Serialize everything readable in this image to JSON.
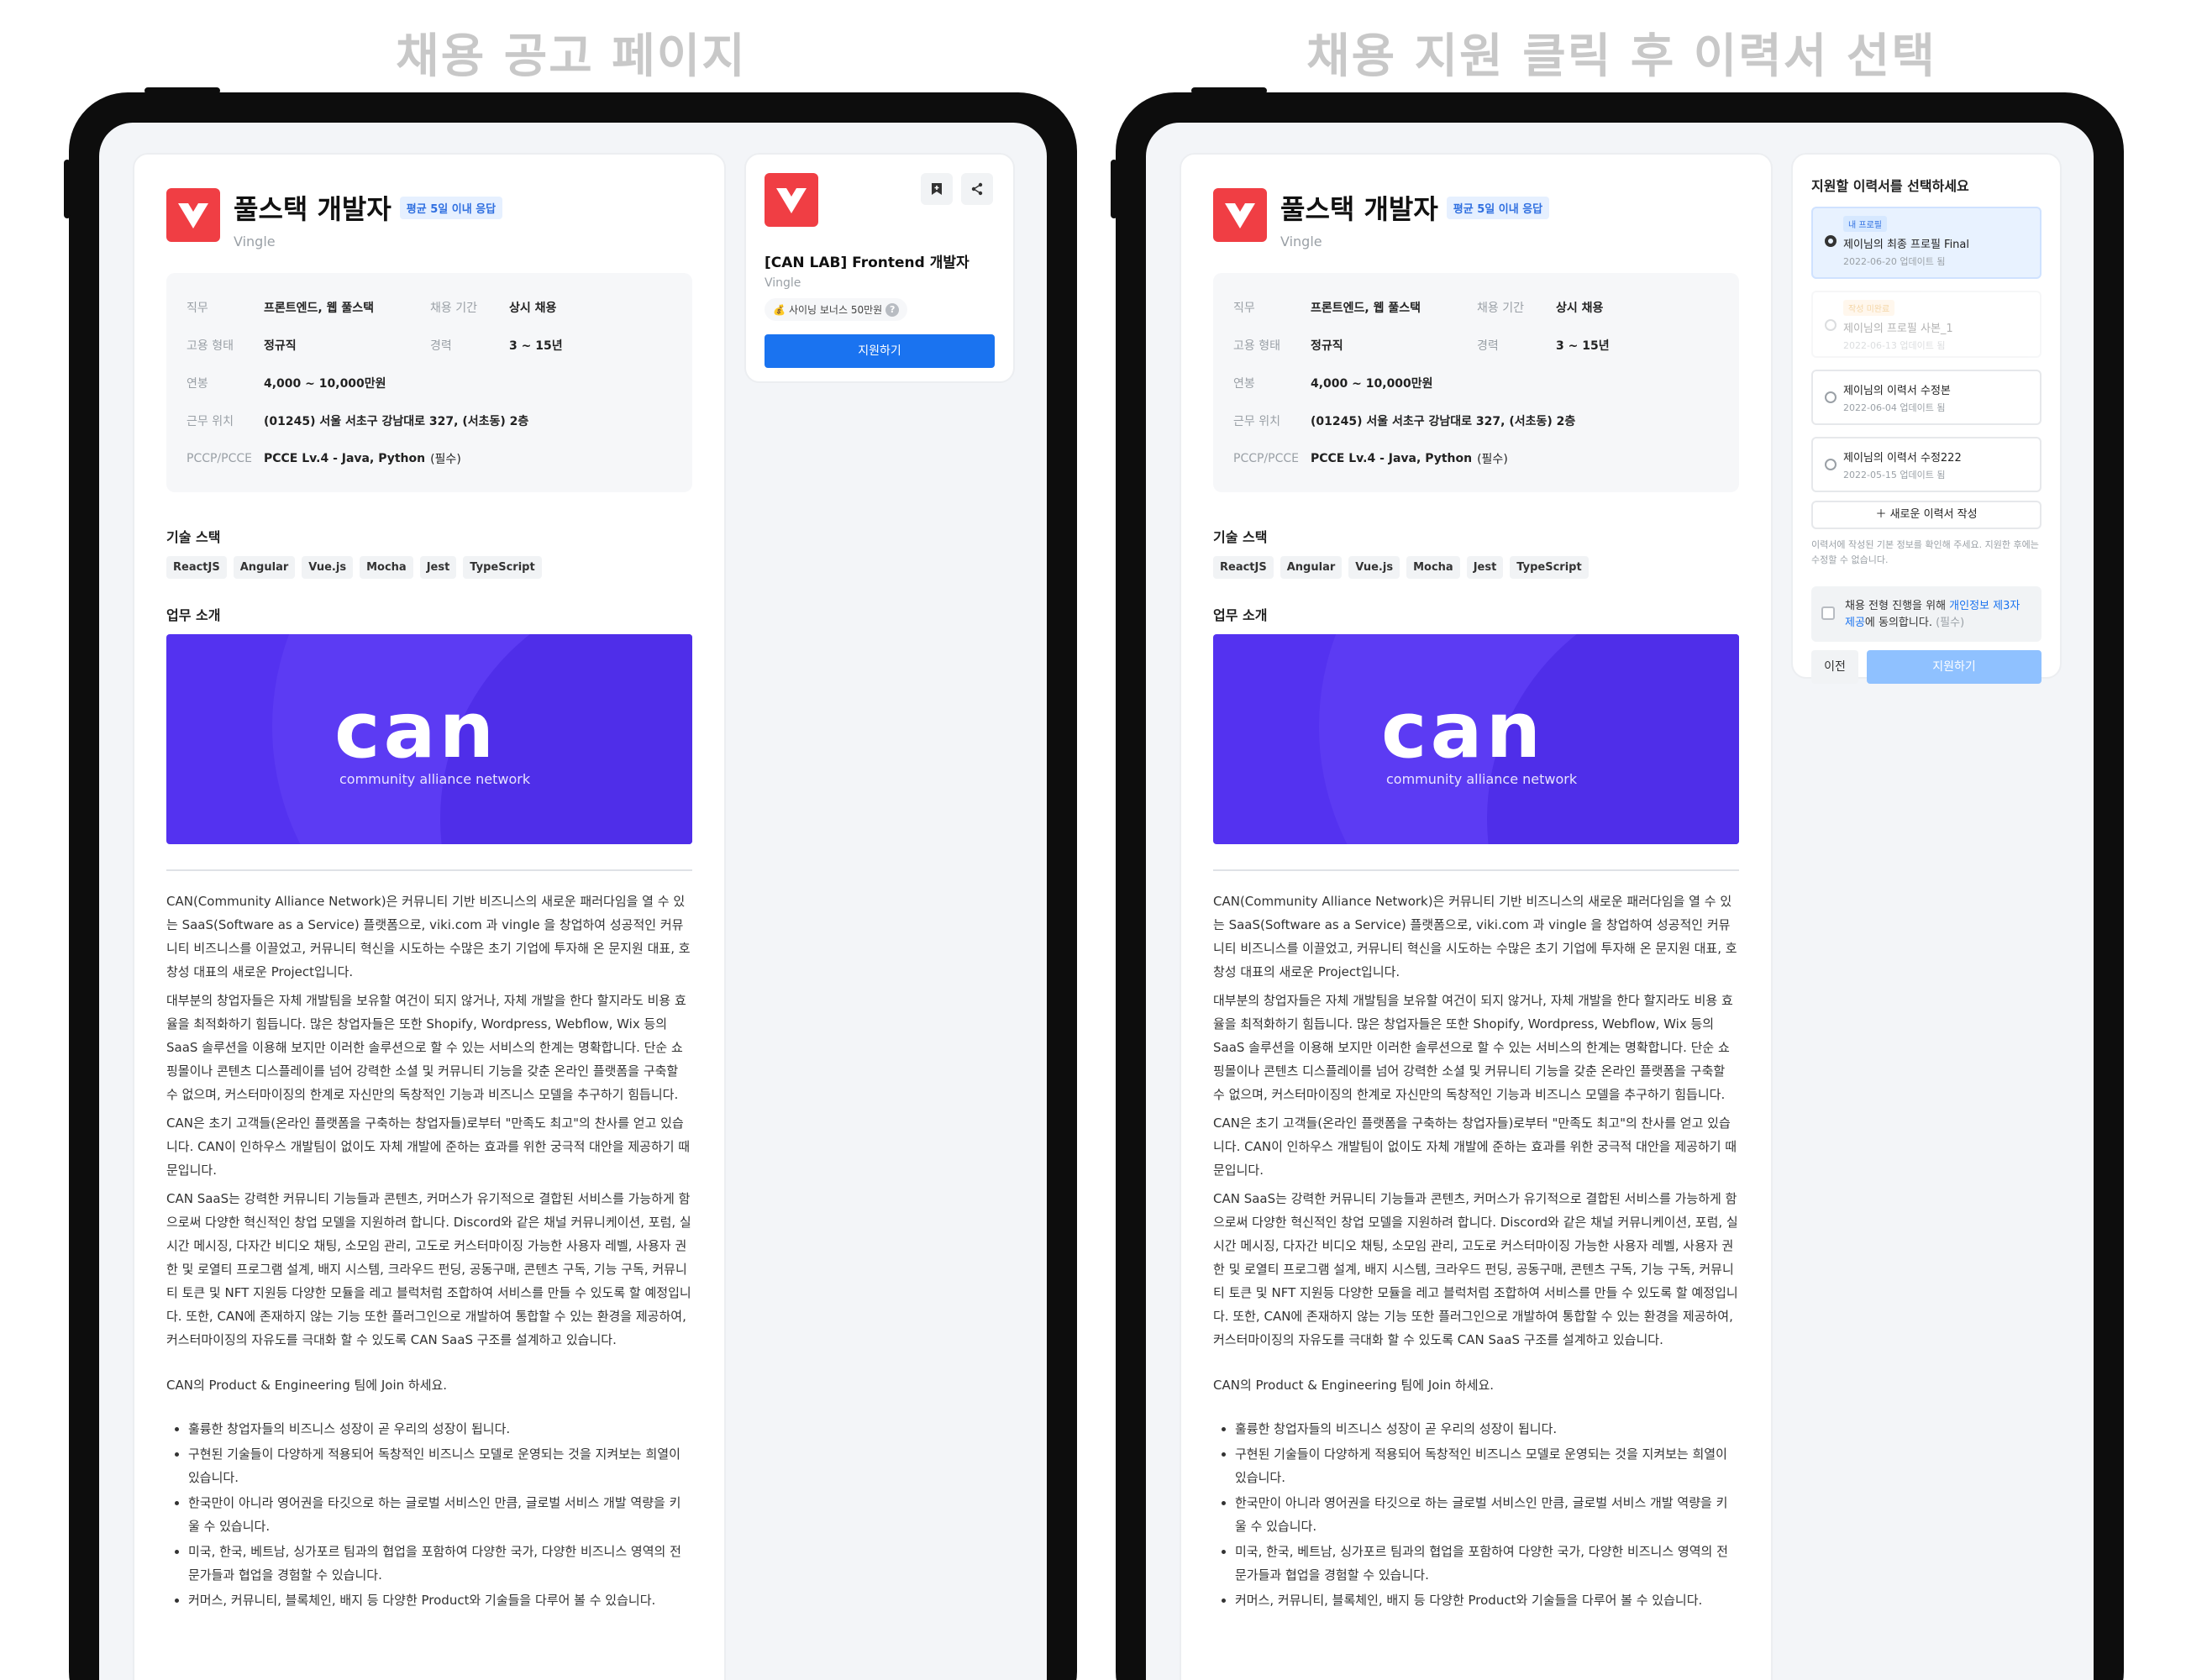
{
  "captions": {
    "left": "채용 공고 페이지",
    "right": "채용 지원 클릭 후 이력서 선택"
  },
  "job": {
    "title": "풀스택 개발자",
    "response_badge": "평균 5일 이내 응답",
    "company": "Vingle",
    "info": {
      "role_k": "직무",
      "role_v": "프론트엔드, 웹 풀스택",
      "period_k": "채용 기간",
      "period_v": "상시 채용",
      "type_k": "고용 형태",
      "type_v": "정규직",
      "career_k": "경력",
      "career_v": "3 ~ 15년",
      "salary_k": "연봉",
      "salary_v": "4,000 ~ 10,000만원",
      "location_k": "근무 위치",
      "location_v": "(01245) 서울 서초구 강남대로 327, (서초동) 2층",
      "pccp_k": "PCCP/PCCE",
      "pccp_v": "PCCE Lv.4 - Java, Python",
      "pccp_req": "(필수)"
    },
    "tech_title": "기술 스택",
    "tags": [
      "ReactJS",
      "Angular",
      "Vue.js",
      "Mocha",
      "Jest",
      "TypeScript"
    ],
    "intro_title": "업무 소개",
    "banner": {
      "logo_text": "can",
      "subtitle": "community alliance network"
    },
    "paragraphs": [
      "CAN(Community Alliance Network)은 커뮤니티 기반 비즈니스의 새로운 패러다임을 열 수 있는 SaaS(Software as a Service) 플랫폼으로, viki.com 과 vingle 을 창업하여 성공적인 커뮤니티 비즈니스를 이끌었고, 커뮤니티 혁신을 시도하는 수많은 초기 기업에 투자해 온 문지원 대표, 호창성 대표의 새로운 Project입니다.",
      "대부분의 창업자들은 자체 개발팀을 보유할 여건이 되지 않거나, 자체 개발을 한다 할지라도 비용 효율을 최적화하기 힘듭니다. 많은 창업자들은 또한 Shopify, Wordpress, Webflow, Wix 등의 SaaS 솔루션을 이용해 보지만 이러한 솔루션으로 할 수 있는 서비스의 한계는 명확합니다. 단순 쇼핑몰이나 콘텐츠 디스플레이를 넘어 강력한 소셜 및 커뮤니티 기능을 갖춘 온라인 플랫폼을 구축할 수 없으며, 커스터마이징의 한계로 자신만의 독창적인 기능과 비즈니스 모델을 추구하기 힘듭니다.",
      "CAN은 초기 고객들(온라인 플랫폼을 구축하는 창업자들)로부터 \"만족도 최고\"의 찬사를 얻고 있습니다. CAN이 인하우스 개발팀이 없이도 자체 개발에 준하는 효과를 위한 궁극적 대안을 제공하기 때문입니다.",
      "CAN SaaS는 강력한 커뮤니티 기능들과 콘텐츠, 커머스가 유기적으로 결합된 서비스를 가능하게 함으로써 다양한 혁신적인 창업 모델을 지원하려 합니다. Discord와 같은 채널 커뮤니케이션, 포럼, 실시간 메시징, 다자간 비디오 채팅, 소모임 관리, 고도로 커스터마이징 가능한 사용자 레벨, 사용자 권한 및 로열티 프로그램 설계, 배지 시스템, 크라우드 펀딩, 공동구매, 콘텐츠 구독, 기능 구독, 커뮤니티 토큰 및 NFT 지원등 다양한 모듈을 레고 블럭처럼 조합하여 서비스를 만들 수 있도록 할 예정입니다. 또한, CAN에 존재하지 않는 기능 또한 플러그인으로 개발하여 통합할 수 있는 환경을 제공하여, 커스터마이징의 자유도를 극대화 할 수 있도록 CAN SaaS 구조를 설계하고 있습니다."
    ],
    "join_line": "CAN의 Product & Engineering 팀에 Join 하세요.",
    "bullets": [
      "훌륭한 창업자들의 비즈니스 성장이 곧 우리의 성장이 됩니다.",
      "구현된 기술들이 다양하게 적용되어 독창적인 비즈니스 모델로 운영되는 것을 지켜보는 희열이 있습니다.",
      "한국만이 아니라 영어권을 타깃으로 하는 글로벌 서비스인 만큼, 글로벌 서비스 개발 역량을 키울 수 있습니다.",
      "미국, 한국, 베트남, 싱가포르 팀과의 협업을 포함하여 다양한 국가, 다양한 비즈니스 영역의 전문가들과 협업을 경험할 수 있습니다.",
      "커머스, 커뮤니티, 블록체인, 배지 등 다양한 Product와 기술들을 다루어 볼 수 있습니다."
    ]
  },
  "side": {
    "title": "[CAN LAB] Frontend 개발자",
    "company": "Vingle",
    "bonus": "사이닝 보너스 50만원",
    "apply_label": "지원하기",
    "bookmark_icon": "bookmark-icon",
    "share_icon": "share-icon"
  },
  "resume": {
    "heading": "지원할 이력서를 선택하세요",
    "items": [
      {
        "badge": "내 프로필",
        "name": "제이님의 최종 프로필 Final",
        "date": "2022-06-20 업데이트 됨"
      },
      {
        "badge": "작성 미완료",
        "name": "제이님의 프로필 사본_1",
        "date": "2022-06-13 업데이트 됨"
      },
      {
        "badge": "",
        "name": "제이님의 이력서 수정본",
        "date": "2022-06-04 업데이트 됨"
      },
      {
        "badge": "",
        "name": "제이님의 이력서 수정222",
        "date": "2022-05-15 업데이트 됨"
      }
    ],
    "new_label": "새로운 이력서 작성",
    "note": "이력서에 작성된 기본 정보를 확인해 주세요. 지원한 후에는 수정할 수 없습니다.",
    "consent_pre": "채용 전형 진행을 위해 ",
    "consent_link": "개인정보 제3자 제공",
    "consent_post": "에 동의합니다.",
    "consent_req": "(필수)",
    "prev_label": "이전",
    "submit_label": "지원하기",
    "colors": {
      "selected_bg": "#e8f2ff",
      "submit_disabled": "#8fc1ff",
      "accent": "#1a73f0"
    }
  }
}
